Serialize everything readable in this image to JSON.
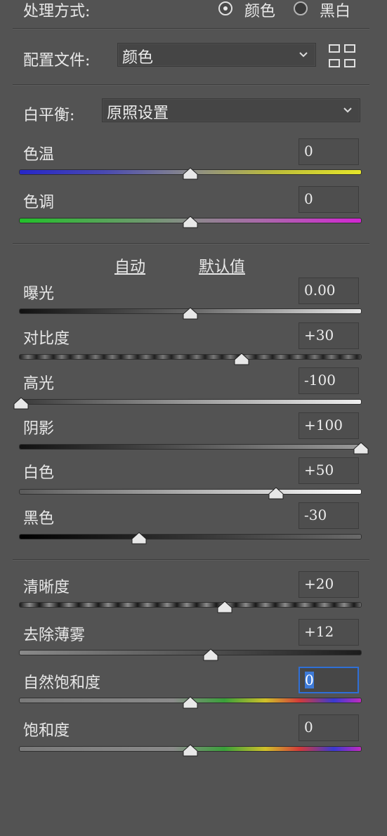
{
  "treatment": {
    "label": "处理方式:",
    "options": [
      "颜色",
      "黑白"
    ],
    "selected": 0
  },
  "profile": {
    "label": "配置文件:",
    "value": "颜色"
  },
  "wb": {
    "label": "白平衡:",
    "value": "原照设置"
  },
  "links": {
    "auto": "自动",
    "default": "默认值"
  },
  "sliders": [
    {
      "label": "色温",
      "value": "0",
      "level": 0.5
    },
    {
      "label": "色调",
      "value": "0",
      "level": 0.5
    },
    {
      "label": "曝光",
      "value": "0.00",
      "level": 0.5
    },
    {
      "label": "对比度",
      "value": "+30",
      "level": 0.65
    },
    {
      "label": "高光",
      "value": "-100",
      "level": 0
    },
    {
      "label": "阴影",
      "value": "+100",
      "level": 1
    },
    {
      "label": "白色",
      "value": "+50",
      "level": 0.75
    },
    {
      "label": "黑色",
      "value": "-30",
      "level": 0.35
    },
    {
      "label": "清晰度",
      "value": "+20",
      "level": 0.6
    },
    {
      "label": "去除薄雾",
      "value": "+12",
      "level": 0.56
    },
    {
      "label": "自然饱和度",
      "value": "0",
      "level": 0.5
    },
    {
      "label": "饱和度",
      "value": "0",
      "level": 0.5
    }
  ],
  "icons": {
    "chevron": "chevron-down-icon",
    "grid": "grid-view-icon"
  },
  "colors": {
    "panel": "#535353",
    "focus": "#2f6fd6"
  }
}
